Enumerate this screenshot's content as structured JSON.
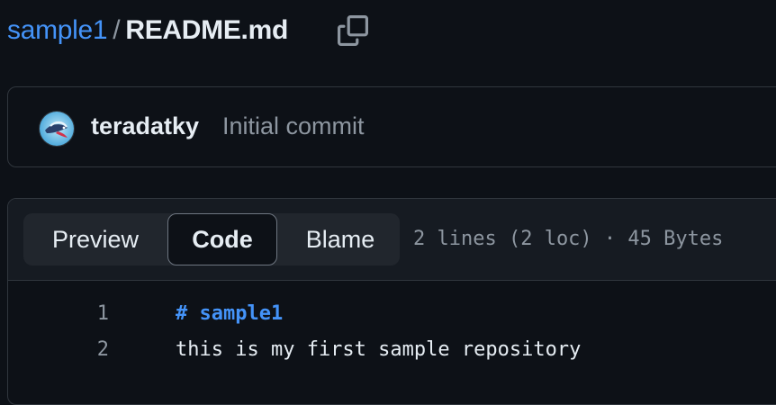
{
  "breadcrumb": {
    "repo": "sample1",
    "separator": "/",
    "file": "README.md"
  },
  "icons": {
    "copy": "copy-icon",
    "avatar": "avatar-fish-icon"
  },
  "commit": {
    "author": "teradatky",
    "message": "Initial commit"
  },
  "view_tabs": [
    {
      "label": "Preview",
      "selected": false
    },
    {
      "label": "Code",
      "selected": true
    },
    {
      "label": "Blame",
      "selected": false
    }
  ],
  "file_info": "2 lines (2 loc) · 45 Bytes",
  "code_lines": [
    {
      "number": "1",
      "text": "# sample1"
    },
    {
      "number": "2",
      "text": "this is my first sample repository"
    }
  ],
  "colors": {
    "background": "#0d1117",
    "link": "#4493f8",
    "border": "#30363d",
    "muted": "#8d96a0"
  }
}
